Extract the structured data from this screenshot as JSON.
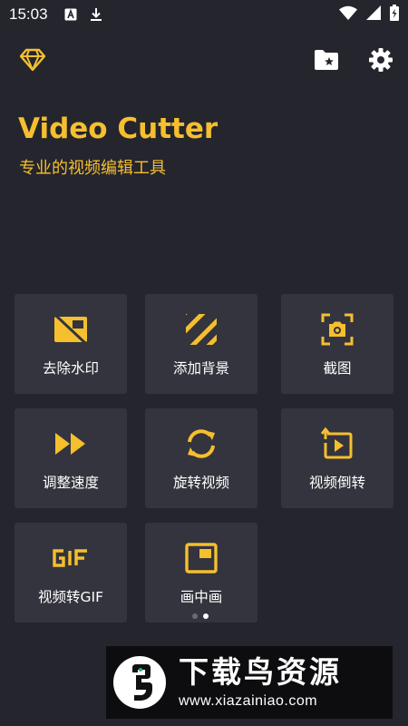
{
  "status_bar": {
    "time": "15:03",
    "icons": [
      "a-box-icon",
      "download-icon",
      "wifi-icon",
      "signal-icon",
      "battery-charging-icon"
    ]
  },
  "topbar": {
    "left_icon": "diamond-icon",
    "right_icons": [
      "folder-star-icon",
      "gear-icon"
    ]
  },
  "app": {
    "title": "Video Cutter",
    "subtitle": "专业的视频编辑工具"
  },
  "tools": [
    {
      "label": "去除水印",
      "icon": "remove-watermark-icon"
    },
    {
      "label": "添加背景",
      "icon": "stripes-background-icon"
    },
    {
      "label": "截图",
      "icon": "screenshot-camera-icon"
    },
    {
      "label": "调整速度",
      "icon": "fast-forward-icon"
    },
    {
      "label": "旋转视频",
      "icon": "rotate-icon"
    },
    {
      "label": "视频倒转",
      "icon": "reverse-video-icon"
    },
    {
      "label": "视频转GIF",
      "icon": "gif-icon"
    },
    {
      "label": "画中画",
      "icon": "picture-in-picture-icon"
    }
  ],
  "pager": {
    "pages": 2,
    "active": 2
  },
  "watermark": {
    "text": "下载鸟资源",
    "url": "www.xiazainiao.com"
  },
  "colors": {
    "background": "#25252e",
    "tile": "#34343e",
    "accent": "#f5bf2e",
    "text": "#ffffff"
  }
}
